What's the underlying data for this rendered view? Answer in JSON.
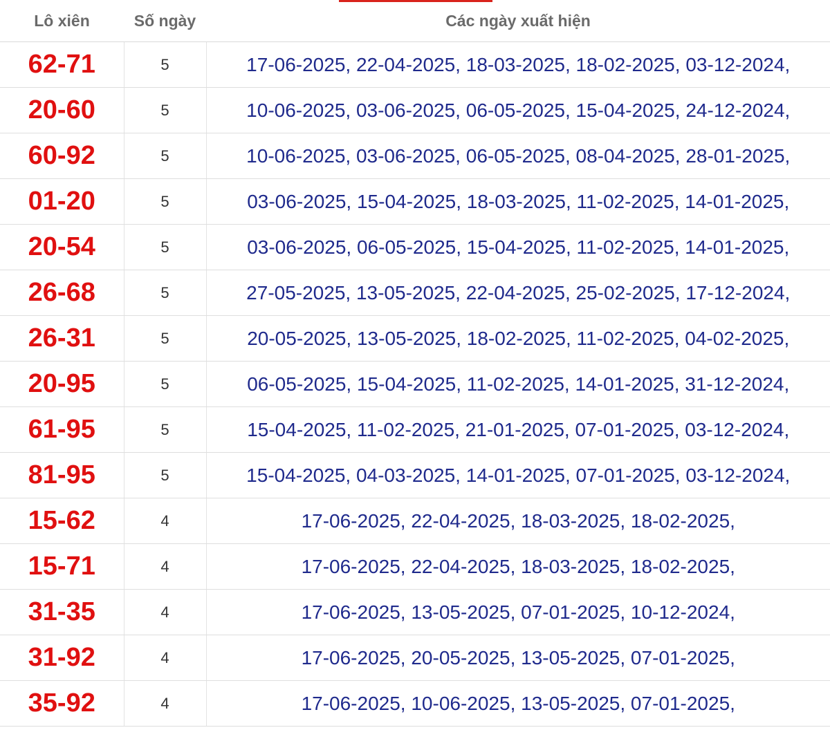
{
  "header": {
    "pair": "Lô xiên",
    "days": "Số ngày",
    "dates": "Các ngày xuất hiện"
  },
  "rows": [
    {
      "pair": "62-71",
      "days": "5",
      "dates": "17-06-2025, 22-04-2025, 18-03-2025, 18-02-2025, 03-12-2024,"
    },
    {
      "pair": "20-60",
      "days": "5",
      "dates": "10-06-2025, 03-06-2025, 06-05-2025, 15-04-2025, 24-12-2024,"
    },
    {
      "pair": "60-92",
      "days": "5",
      "dates": "10-06-2025, 03-06-2025, 06-05-2025, 08-04-2025, 28-01-2025,"
    },
    {
      "pair": "01-20",
      "days": "5",
      "dates": "03-06-2025, 15-04-2025, 18-03-2025, 11-02-2025, 14-01-2025,"
    },
    {
      "pair": "20-54",
      "days": "5",
      "dates": "03-06-2025, 06-05-2025, 15-04-2025, 11-02-2025, 14-01-2025,"
    },
    {
      "pair": "26-68",
      "days": "5",
      "dates": "27-05-2025, 13-05-2025, 22-04-2025, 25-02-2025, 17-12-2024,"
    },
    {
      "pair": "26-31",
      "days": "5",
      "dates": "20-05-2025, 13-05-2025, 18-02-2025, 11-02-2025, 04-02-2025,"
    },
    {
      "pair": "20-95",
      "days": "5",
      "dates": "06-05-2025, 15-04-2025, 11-02-2025, 14-01-2025, 31-12-2024,"
    },
    {
      "pair": "61-95",
      "days": "5",
      "dates": "15-04-2025, 11-02-2025, 21-01-2025, 07-01-2025, 03-12-2024,"
    },
    {
      "pair": "81-95",
      "days": "5",
      "dates": "15-04-2025, 04-03-2025, 14-01-2025, 07-01-2025, 03-12-2024,"
    },
    {
      "pair": "15-62",
      "days": "4",
      "dates": "17-06-2025, 22-04-2025, 18-03-2025, 18-02-2025,"
    },
    {
      "pair": "15-71",
      "days": "4",
      "dates": "17-06-2025, 22-04-2025, 18-03-2025, 18-02-2025,"
    },
    {
      "pair": "31-35",
      "days": "4",
      "dates": "17-06-2025, 13-05-2025, 07-01-2025, 10-12-2024,"
    },
    {
      "pair": "31-92",
      "days": "4",
      "dates": "17-06-2025, 20-05-2025, 13-05-2025, 07-01-2025,"
    },
    {
      "pair": "35-92",
      "days": "4",
      "dates": "17-06-2025, 10-06-2025, 13-05-2025, 07-01-2025,"
    }
  ],
  "colors": {
    "pair": "#e01010",
    "dates": "#1f2a8c",
    "header": "#6a6a6a",
    "accent": "#d9231c"
  }
}
